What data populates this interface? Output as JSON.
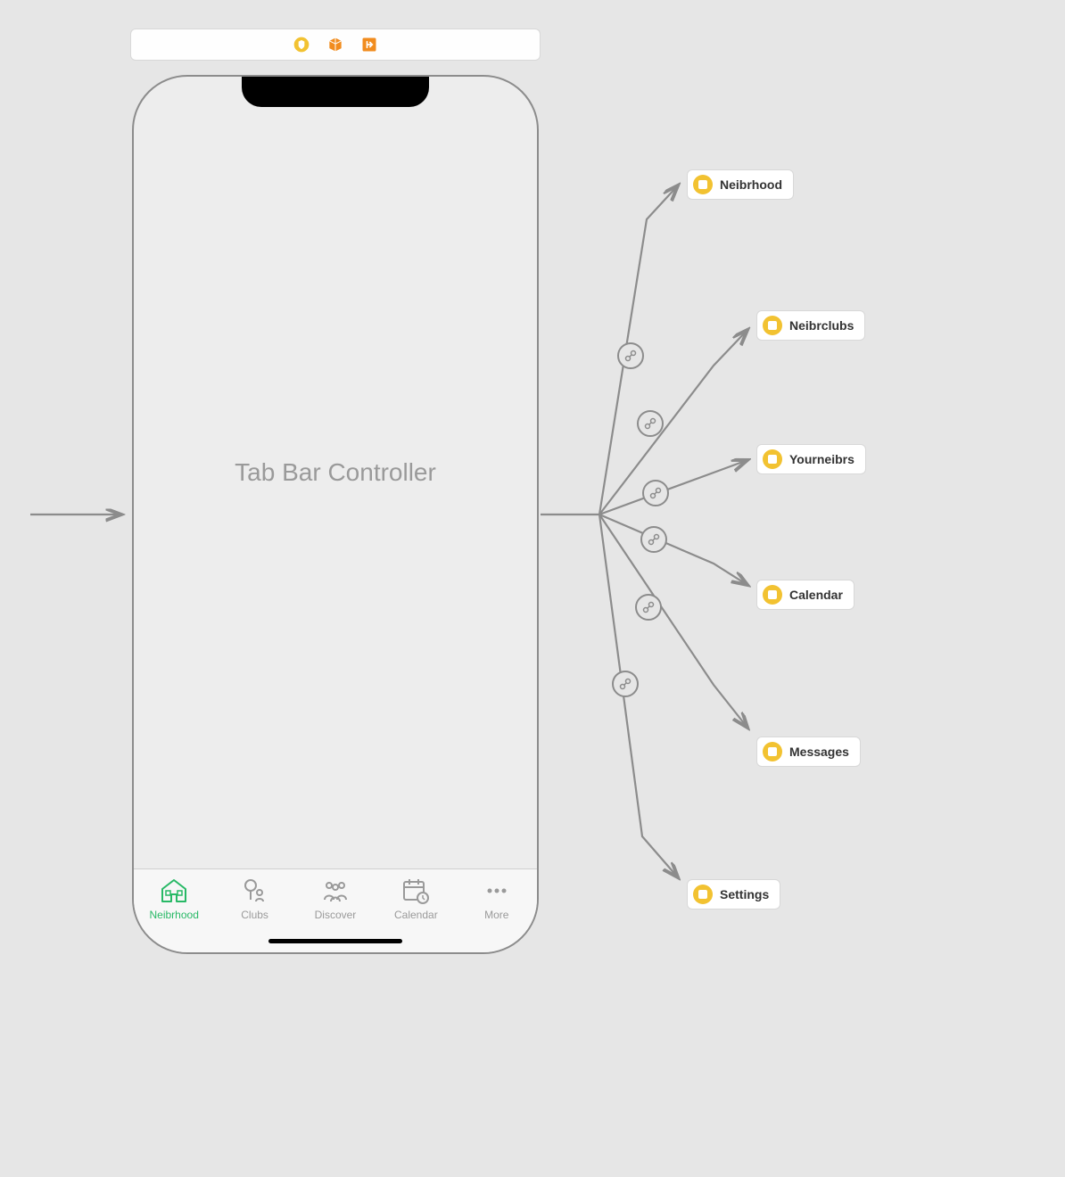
{
  "toolbar": {
    "icons": [
      "shield-icon",
      "cube-icon",
      "exit-icon"
    ]
  },
  "phone": {
    "title": "Tab Bar Controller",
    "tabs": [
      {
        "label": "Neibrhood",
        "icon": "house-icon",
        "active": true
      },
      {
        "label": "Clubs",
        "icon": "tree-people-icon",
        "active": false
      },
      {
        "label": "Discover",
        "icon": "people-group-icon",
        "active": false
      },
      {
        "label": "Calendar",
        "icon": "calendar-clock-icon",
        "active": false
      },
      {
        "label": "More",
        "icon": "more-dots-icon",
        "active": false
      }
    ]
  },
  "destinations": [
    {
      "label": "Neibrhood"
    },
    {
      "label": "Neibrclubs"
    },
    {
      "label": "Yourneibrs"
    },
    {
      "label": "Calendar"
    },
    {
      "label": "Messages"
    },
    {
      "label": "Settings"
    }
  ],
  "colors": {
    "active_tab": "#28b966",
    "inactive": "#9a9a9a",
    "chip_icon_bg": "#f2c231",
    "toolbar_orange": "#f18c1e",
    "line": "#8c8c8c"
  }
}
